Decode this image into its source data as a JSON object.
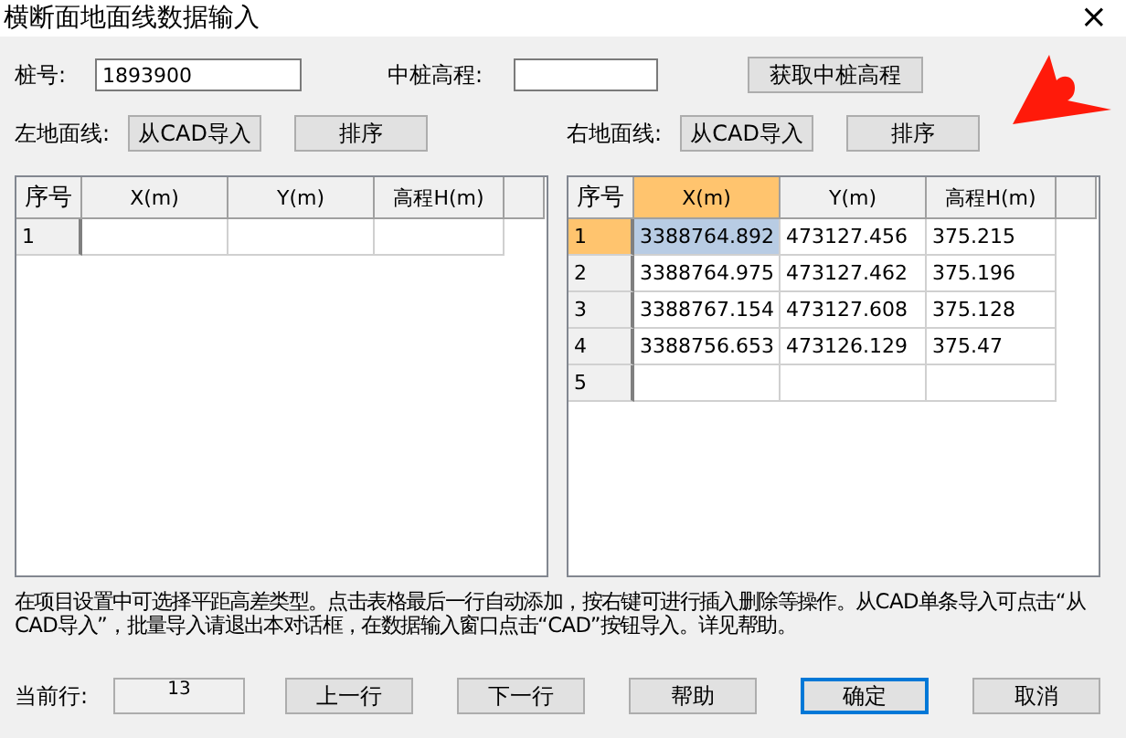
{
  "window": {
    "title": "横断面地面线数据输入",
    "close": "×"
  },
  "station": {
    "label": "桩号:",
    "value": "1893900"
  },
  "center_elevation": {
    "label": "中桩高程:"
  },
  "get_elevation_button": "获取中桩高程",
  "left_line": {
    "label": "左地面线:",
    "import_button": "从CAD导入",
    "sort_button": "排序"
  },
  "right_line": {
    "label": "右地面线:",
    "import_button": "从CAD导入",
    "sort_button": "排序"
  },
  "left_table": {
    "columns": [
      {
        "label": "序号",
        "selected": false
      },
      {
        "label": "X(m)",
        "selected": false
      },
      {
        "label": "Y(m)",
        "selected": false
      },
      {
        "label": "高程H(m)",
        "selected": false
      }
    ],
    "rows": [
      {
        "selected": false,
        "cells": [
          "1",
          "",
          "",
          ""
        ]
      }
    ]
  },
  "right_table": {
    "columns": [
      {
        "label": "序号",
        "selected": false
      },
      {
        "label": "X(m)",
        "selected": true
      },
      {
        "label": "Y(m)",
        "selected": false
      },
      {
        "label": "高程H(m)",
        "selected": false
      }
    ],
    "rows": [
      {
        "selected": true,
        "cells": [
          "1",
          "3388764.892",
          "473127.456",
          "375.215"
        ]
      },
      {
        "selected": false,
        "cells": [
          "2",
          "3388764.975",
          "473127.462",
          "375.196"
        ]
      },
      {
        "selected": false,
        "cells": [
          "3",
          "3388767.154",
          "473127.608",
          "375.128"
        ]
      },
      {
        "selected": false,
        "cells": [
          "4",
          "3388756.653",
          "473126.129",
          "375.47"
        ]
      },
      {
        "selected": false,
        "cells": [
          "5",
          "",
          "",
          ""
        ]
      }
    ]
  },
  "help_text": "在项目设置中可选择平距高差类型。点击表格最后一行自动添加，按右键可进行插入删除等操作。从CAD单条导入可点击“从CAD导入”，批量导入请退出本对话框，在数据输入窗口点击“CAD”按钮导入。详见帮助。",
  "current_row": {
    "label": "当前行:",
    "value": "13"
  },
  "buttons": [
    {
      "label": "上一行",
      "default": false
    },
    {
      "label": "下一行",
      "default": false
    },
    {
      "label": "帮助",
      "default": false
    },
    {
      "label": "确定",
      "default": true
    },
    {
      "label": "取消",
      "default": false
    }
  ]
}
